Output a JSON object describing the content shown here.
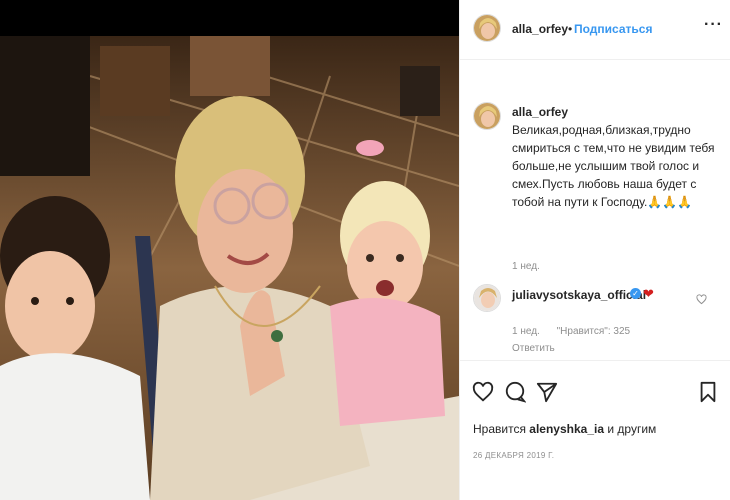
{
  "post": {
    "author": "alla_orfey",
    "follow_label": "Подписаться",
    "more_label": "···",
    "caption": "Великая,родная,близкая,трудно смириться с тем,что не увидим тебя больше,не услышим твой голос и смех.Пусть любовь наша будет с тобой на пути к Господу.🙏🙏🙏",
    "caption_time": "1 нед.",
    "likes_prefix": "Нравится",
    "likes_user": "alenyshka_ia",
    "likes_suffix": "и другим",
    "date": "26 ДЕКАБРЯ 2019 Г."
  },
  "comment": {
    "user": "juliavysotskaya_official",
    "text": "❤",
    "time": "1 нед.",
    "likes": "\"Нравится\": 325",
    "reply": "Ответить"
  },
  "icons": {
    "like": "heart-icon",
    "comment": "comment-icon",
    "share": "share-icon",
    "save": "bookmark-icon",
    "verified": "verified-badge-icon"
  },
  "colors": {
    "follow": "#3897f0",
    "verified": "#3897f0",
    "heart": "#d31f1f"
  }
}
